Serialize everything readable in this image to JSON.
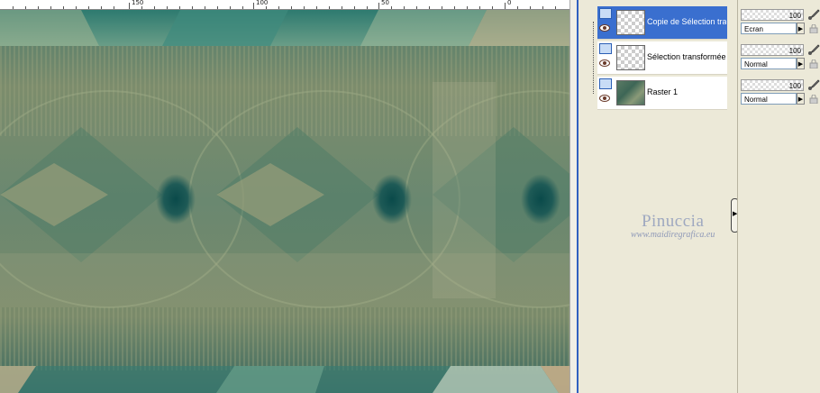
{
  "ruler": {
    "labels": [
      "150",
      "100",
      "50",
      "0"
    ]
  },
  "layers": [
    {
      "name": "Copie de Sélection tra",
      "selected": true,
      "thumbnail": "transparent"
    },
    {
      "name": "Sélection transformée",
      "selected": false,
      "thumbnail": "transparent"
    },
    {
      "name": "Raster 1",
      "selected": false,
      "thumbnail": "raster"
    }
  ],
  "properties": [
    {
      "opacity": "100",
      "blend_mode": "Ecran"
    },
    {
      "opacity": "100",
      "blend_mode": "Normal"
    },
    {
      "opacity": "100",
      "blend_mode": "Normal"
    }
  ],
  "watermark": {
    "name": "Pinuccia",
    "url": "www.maidiregrafica.eu"
  },
  "icons": {
    "visibility": "eye-icon",
    "layer_type": "layer-icon",
    "brush": "brush-icon",
    "lock": "lock-icon",
    "dropdown": "dropdown-arrow-icon"
  },
  "colors": {
    "selection_highlight": "#3a6fcf",
    "panel_bg": "#ece9d8"
  }
}
